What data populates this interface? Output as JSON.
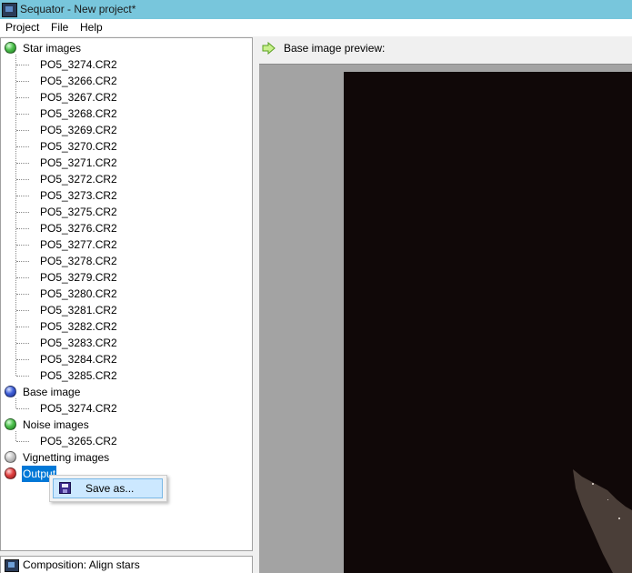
{
  "window": {
    "title": "Sequator - New project*"
  },
  "menu": {
    "items": [
      "Project",
      "File",
      "Help"
    ]
  },
  "tree": {
    "star_images": {
      "label": "Star images",
      "files": [
        "PO5_3274.CR2",
        "PO5_3266.CR2",
        "PO5_3267.CR2",
        "PO5_3268.CR2",
        "PO5_3269.CR2",
        "PO5_3270.CR2",
        "PO5_3271.CR2",
        "PO5_3272.CR2",
        "PO5_3273.CR2",
        "PO5_3275.CR2",
        "PO5_3276.CR2",
        "PO5_3277.CR2",
        "PO5_3278.CR2",
        "PO5_3279.CR2",
        "PO5_3280.CR2",
        "PO5_3281.CR2",
        "PO5_3282.CR2",
        "PO5_3283.CR2",
        "PO5_3284.CR2",
        "PO5_3285.CR2"
      ]
    },
    "base_image": {
      "label": "Base image",
      "files": [
        "PO5_3274.CR2"
      ]
    },
    "noise_images": {
      "label": "Noise images",
      "files": [
        "PO5_3265.CR2"
      ]
    },
    "vignetting_images": {
      "label": "Vignetting images"
    },
    "output": {
      "label": "Output"
    }
  },
  "context_menu": {
    "save_as": "Save as..."
  },
  "status": {
    "composition": "Composition: Align stars"
  },
  "preview": {
    "label": "Base image preview:"
  },
  "colors": {
    "titlebar": "#78c6dc",
    "selection": "#0078d7",
    "menu_highlight": "#cce8ff"
  }
}
